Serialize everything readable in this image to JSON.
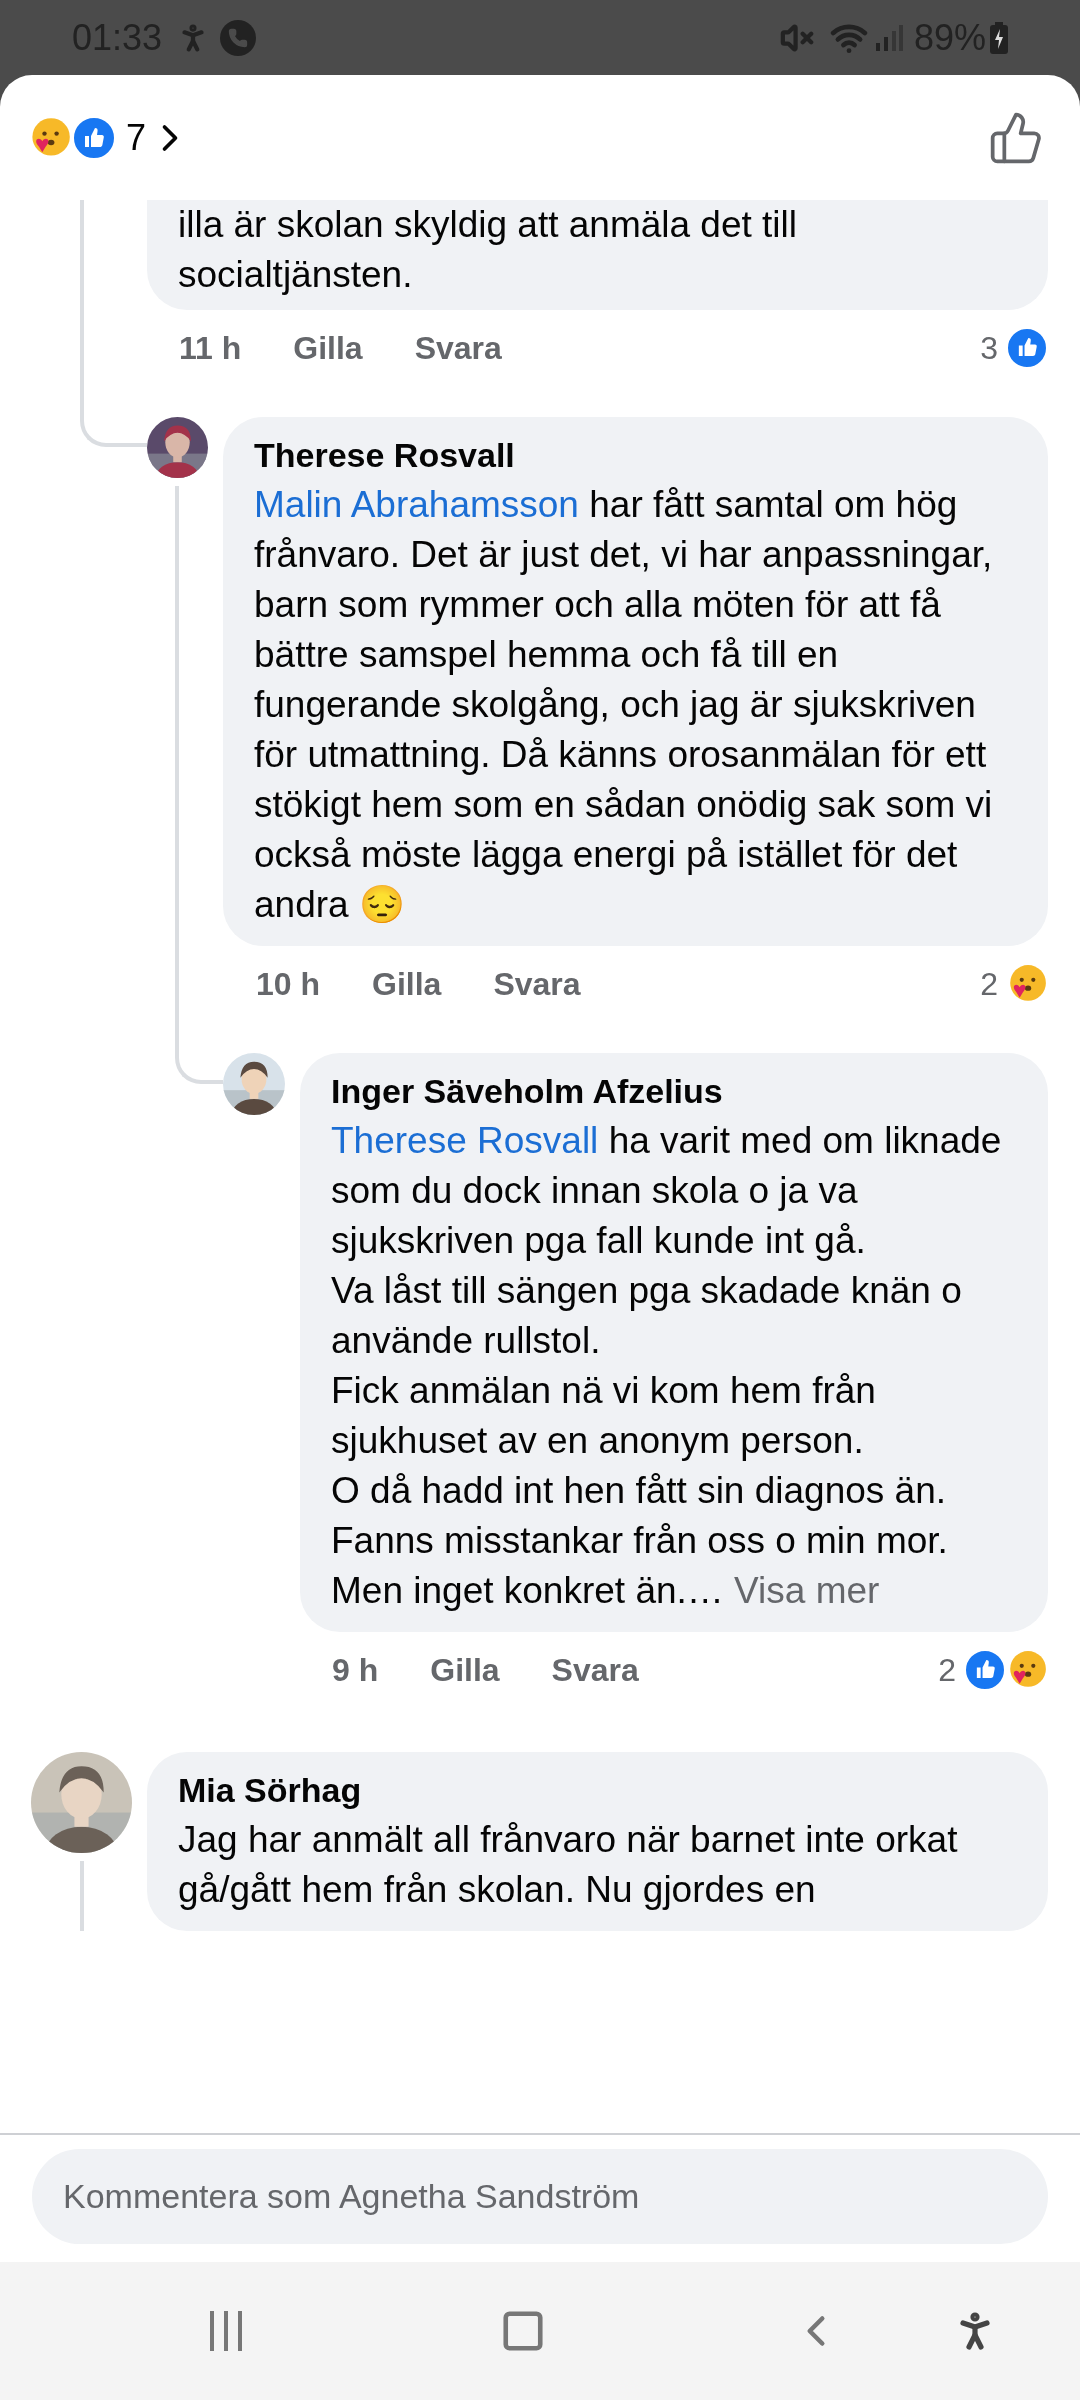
{
  "status_bar": {
    "time": "01:33",
    "battery": "89%"
  },
  "header": {
    "reactions": [
      {
        "kind": "care"
      },
      {
        "kind": "like"
      }
    ],
    "reaction_count": "7"
  },
  "comments": [
    {
      "text": "illa är skolan skyldig att anmäla det till socialtjänsten.",
      "time": "11 h",
      "like_label": "Gilla",
      "reply_label": "Svara",
      "reaction_count": "3",
      "reactions": [
        {
          "kind": "like"
        }
      ],
      "replies": [
        {
          "author": "Therese Rosvall",
          "avatar": {
            "kind": "picture"
          },
          "mention": "Malin Abrahamsson",
          "text": "har fått samtal om hög frånvaro. Det är just det, vi har anpassningar, barn som rymmer och alla möten för att få bättre samspel hemma och få till en fungerande skolgång, och jag är sjukskriven för utmattning. Då känns orosanmälan för ett stökigt hem som en sådan onödig sak som vi också möste lägga energi på istället för det andra 😔",
          "time": "10 h",
          "like_label": "Gilla",
          "reply_label": "Svara",
          "reaction_count": "2",
          "reactions": [
            {
              "kind": "care"
            }
          ],
          "replies": [
            {
              "author": "Inger Säveholm Afzelius",
              "avatar": {
                "kind": "picture"
              },
              "mention": "Therese Rosvall",
              "text": "ha varit med om liknade som du dock innan skola o ja va sjukskriven pga fall kunde int gå.\nVa låst till sängen pga skadade knän o använde rullstol.\nFick anmälan nä vi kom hem från sjukhuset av en anonym person.\nO då hadd int hen fått sin diagnos än.\nFanns misstankar från oss o min mor. Men inget konkret än.…",
              "see_more": "Visa mer",
              "time": "9 h",
              "like_label": "Gilla",
              "reply_label": "Svara",
              "reaction_count": "2",
              "reactions": [
                {
                  "kind": "like"
                },
                {
                  "kind": "care"
                }
              ]
            }
          ]
        }
      ]
    },
    {
      "author": "Mia Sörhag",
      "avatar": {
        "kind": "picture"
      },
      "text": "Jag har anmält all frånvaro när barnet inte orkat gå/gått hem från skolan. Nu gjordes en",
      "has_replies": true
    }
  ],
  "composer": {
    "placeholder": "Kommentera som Agnetha Sandström"
  }
}
